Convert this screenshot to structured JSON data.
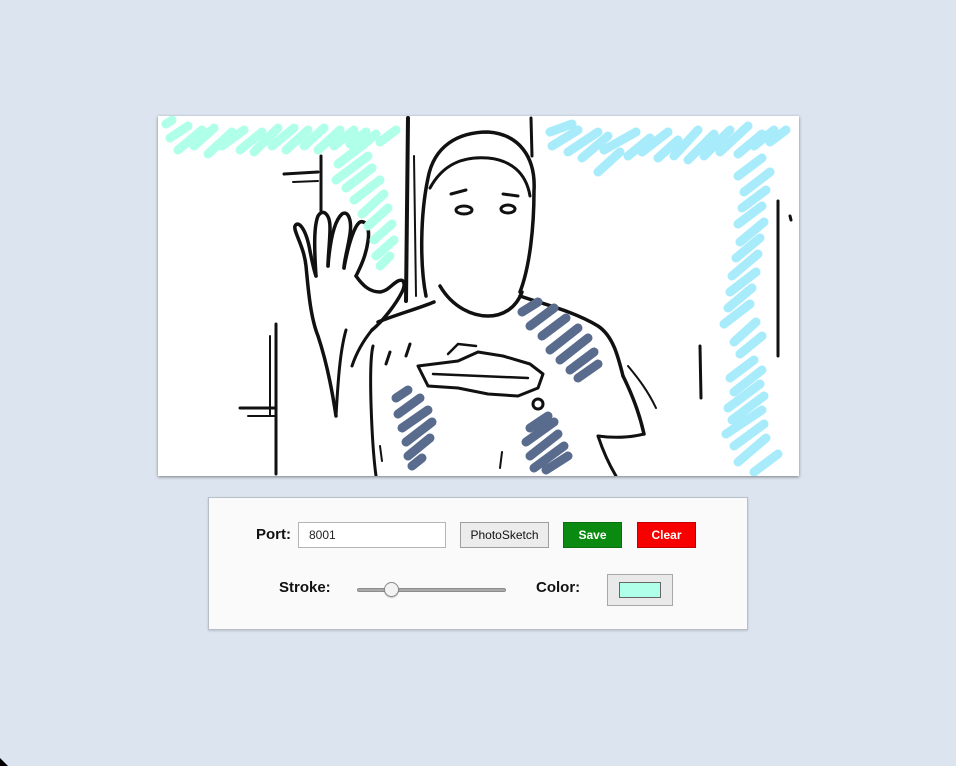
{
  "controls": {
    "port_label": "Port:",
    "port_value": "8001",
    "photosketch_label": "PhotoSketch",
    "save_label": "Save",
    "clear_label": "Clear",
    "stroke_label": "Stroke:",
    "stroke_level": 0.2,
    "color_label": "Color:",
    "selected_color": "#b0ffe8"
  },
  "colors": {
    "background": "#dbe4ef",
    "save_button": "#0b8a12",
    "clear_button": "#f80000",
    "stroke_mint": "#b0ffe8",
    "stroke_cyan": "#a8ecfc",
    "stroke_navy": "#5a6c8e"
  },
  "sketch": {
    "subject": "line-drawing of person waving",
    "stroke_colors": [
      "mint",
      "cyan",
      "navy"
    ]
  }
}
